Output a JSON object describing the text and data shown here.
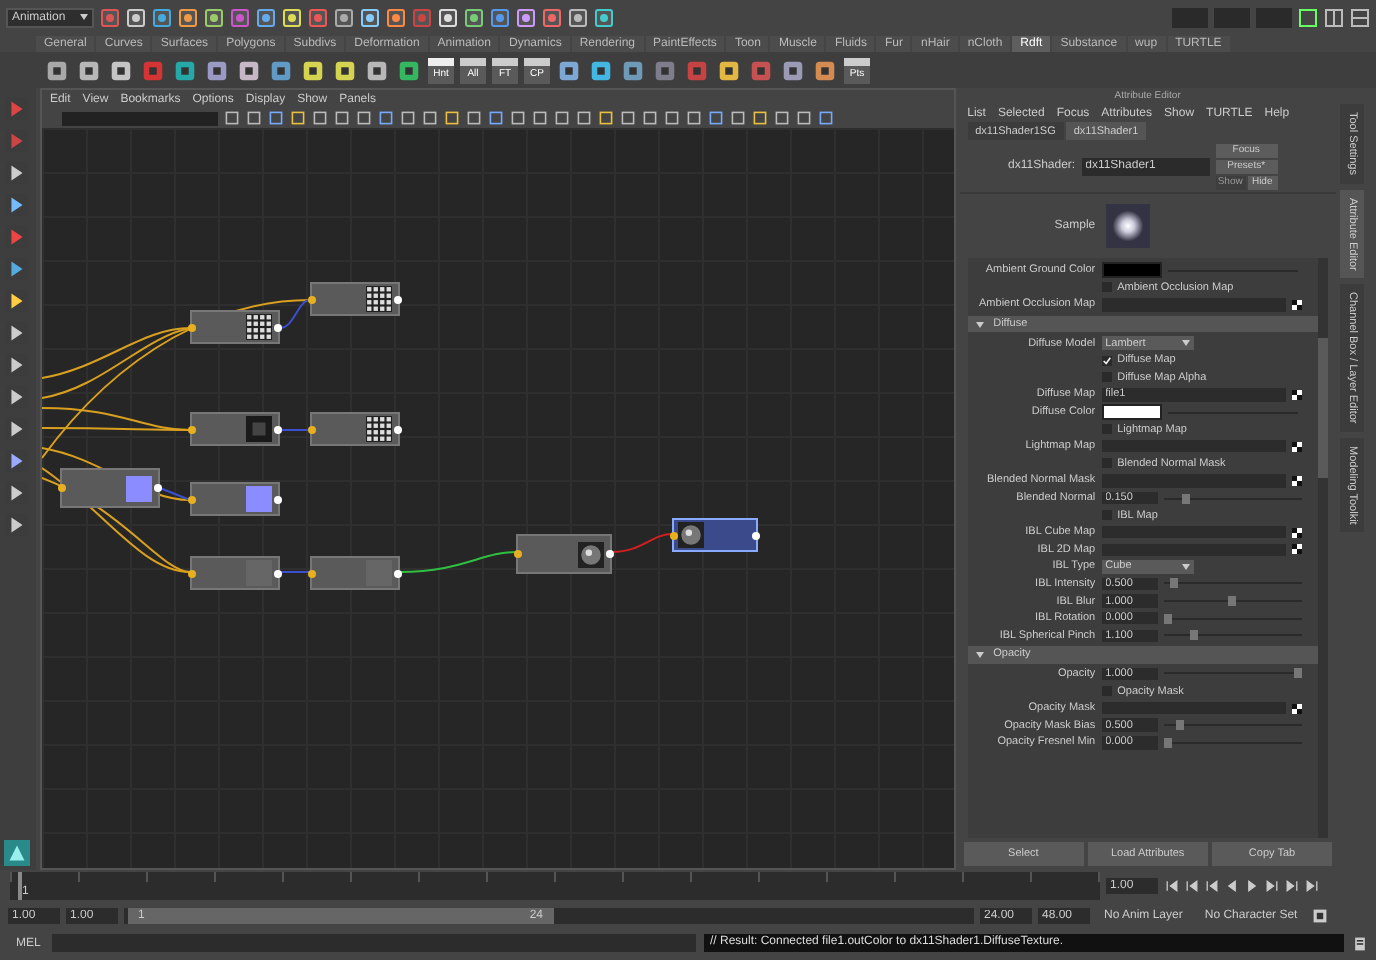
{
  "menu_set": "Animation",
  "shelf_tabs": [
    {
      "label": "General",
      "selected": false
    },
    {
      "label": "Curves",
      "selected": false
    },
    {
      "label": "Surfaces",
      "selected": false
    },
    {
      "label": "Polygons",
      "selected": false
    },
    {
      "label": "Subdivs",
      "selected": false
    },
    {
      "label": "Deformation",
      "selected": false
    },
    {
      "label": "Animation",
      "selected": false
    },
    {
      "label": "Dynamics",
      "selected": false
    },
    {
      "label": "Rendering",
      "selected": false
    },
    {
      "label": "PaintEffects",
      "selected": false
    },
    {
      "label": "Toon",
      "selected": false
    },
    {
      "label": "Muscle",
      "selected": false
    },
    {
      "label": "Fluids",
      "selected": false
    },
    {
      "label": "Fur",
      "selected": false
    },
    {
      "label": "nHair",
      "selected": false
    },
    {
      "label": "nCloth",
      "selected": false
    },
    {
      "label": "Rdft",
      "selected": true
    },
    {
      "label": "Substance",
      "selected": false
    },
    {
      "label": "wup",
      "selected": false
    },
    {
      "label": "TURTLE",
      "selected": false
    }
  ],
  "shelf_labels": [
    "Hnt",
    "All",
    "FT",
    "CP",
    "Pts"
  ],
  "hypershade": {
    "menu": [
      "Edit",
      "View",
      "Bookmarks",
      "Options",
      "Display",
      "Show",
      "Panels"
    ],
    "nodes": [
      {
        "kind": "grid",
        "selected": false
      },
      {
        "kind": "grid",
        "selected": false
      },
      {
        "kind": "dark",
        "selected": false
      },
      {
        "kind": "grid",
        "selected": false
      },
      {
        "kind": "blue",
        "selected": false
      },
      {
        "kind": "blue",
        "selected": false
      },
      {
        "kind": "plain",
        "selected": false
      },
      {
        "kind": "plain",
        "selected": false
      },
      {
        "kind": "sphere",
        "selected": false
      },
      {
        "kind": "sphere",
        "selected": true
      }
    ]
  },
  "attribute_editor": {
    "title": "Attribute Editor",
    "menu": [
      "List",
      "Selected",
      "Focus",
      "Attributes",
      "Show",
      "TURTLE",
      "Help"
    ],
    "tabs": [
      {
        "label": "dx11Shader1SG",
        "selected": false
      },
      {
        "label": "dx11Shader1",
        "selected": true
      }
    ],
    "node_label": "dx11Shader:",
    "node_name": "dx11Shader1",
    "buttons": [
      {
        "label": "Focus",
        "disabled": false
      },
      {
        "label": "Presets*",
        "disabled": false
      },
      {
        "label": "Show",
        "disabled": true
      },
      {
        "label": "Hide",
        "disabled": false
      }
    ],
    "sample_label": "Sample",
    "rows": [
      {
        "kind": "color",
        "label": "Ambient Ground Color",
        "color": "#000000"
      },
      {
        "kind": "check",
        "label": "Ambient Occlusion Map",
        "checked": false
      },
      {
        "kind": "map",
        "label": "Ambient Occlusion Map"
      },
      {
        "kind": "section",
        "label": "Diffuse",
        "expanded": true
      },
      {
        "kind": "select",
        "label": "Diffuse Model",
        "value": "Lambert"
      },
      {
        "kind": "check",
        "label": "Diffuse Map",
        "checked": true
      },
      {
        "kind": "check",
        "label": "Diffuse Map Alpha",
        "checked": false
      },
      {
        "kind": "map",
        "label": "Diffuse Map",
        "value": "file1"
      },
      {
        "kind": "color",
        "label": "Diffuse Color",
        "color": "#ffffff"
      },
      {
        "kind": "check",
        "label": "Lightmap Map",
        "checked": false
      },
      {
        "kind": "map",
        "label": "Lightmap Map"
      },
      {
        "kind": "check",
        "label": "Blended Normal Mask",
        "checked": false
      },
      {
        "kind": "map",
        "label": "Blended Normal Mask"
      },
      {
        "kind": "slider",
        "label": "Blended Normal",
        "value": "0.150",
        "level": 0.15
      },
      {
        "kind": "check",
        "label": "IBL Map",
        "checked": false
      },
      {
        "kind": "map",
        "label": "IBL Cube Map"
      },
      {
        "kind": "map",
        "label": "IBL 2D Map"
      },
      {
        "kind": "select",
        "label": "IBL Type",
        "value": "Cube"
      },
      {
        "kind": "slider",
        "label": "IBL Intensity",
        "value": "0.500",
        "level": 0.05
      },
      {
        "kind": "slider",
        "label": "IBL Blur",
        "value": "1.000",
        "level": 0.5
      },
      {
        "kind": "slider",
        "label": "IBL Rotation",
        "value": "0.000",
        "level": 0.0
      },
      {
        "kind": "slider",
        "label": "IBL Spherical Pinch",
        "value": "1.100",
        "level": 0.2
      },
      {
        "kind": "section",
        "label": "Opacity",
        "expanded": true
      },
      {
        "kind": "slider",
        "label": "Opacity",
        "value": "1.000",
        "level": 1.0
      },
      {
        "kind": "check",
        "label": "Opacity Mask",
        "checked": false
      },
      {
        "kind": "map",
        "label": "Opacity Mask"
      },
      {
        "kind": "slider",
        "label": "Opacity Mask Bias",
        "value": "0.500",
        "level": 0.1
      },
      {
        "kind": "slider",
        "label": "Opacity Fresnel Min",
        "value": "0.000",
        "level": 0.0
      }
    ],
    "footer_buttons": [
      "Select",
      "Load Attributes",
      "Copy Tab"
    ]
  },
  "side_tabs": [
    {
      "label": "Tool Settings",
      "selected": false
    },
    {
      "label": "Attribute Editor",
      "selected": true
    },
    {
      "label": "Channel Box / Layer Editor",
      "selected": false
    },
    {
      "label": "Modeling Toolkit",
      "selected": false
    }
  ],
  "time_slider": {
    "start_label": "1",
    "current": "1.00",
    "level": 0.0
  },
  "range_slider": {
    "level": 0.5,
    "start": "1.00",
    "inner_start": "1.00",
    "slider_start": "1",
    "slider_end": "24",
    "inner_end": "24.00",
    "end": "48.00",
    "anim_layer": "No Anim Layer",
    "character_set": "No Character Set"
  },
  "command_line": {
    "label": "MEL",
    "result": "// Result: Connected file1.outColor to dx11Shader1.DiffuseTexture."
  }
}
